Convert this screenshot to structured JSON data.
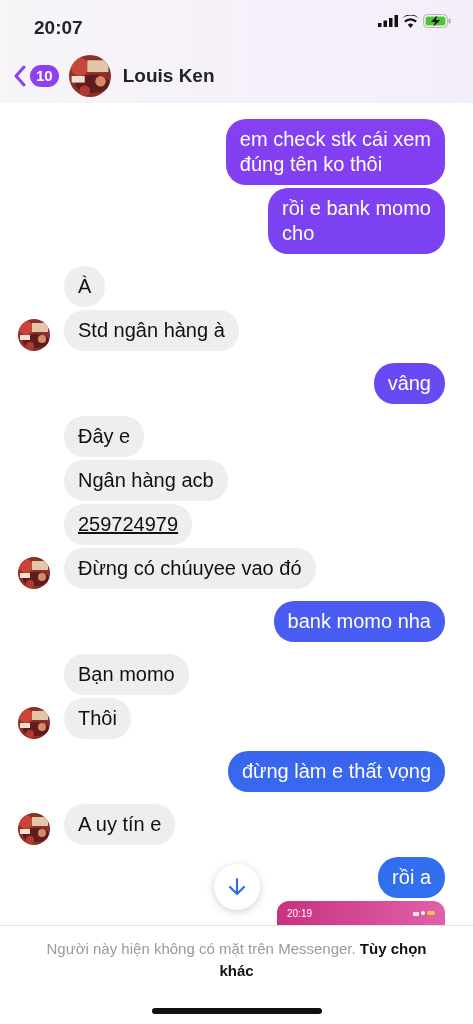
{
  "status_bar": {
    "time": "20:07"
  },
  "header": {
    "back_count": "10",
    "contact_name": "Louis Ken"
  },
  "messages": [
    {
      "outgoing": true,
      "kind": "text",
      "text": "em check stk cái xem\nđúng tên ko thôi"
    },
    {
      "outgoing": true,
      "kind": "text",
      "text": "rồi e bank momo\ncho"
    },
    {
      "outgoing": false,
      "kind": "text",
      "text": "À",
      "avatar": false
    },
    {
      "outgoing": false,
      "kind": "text",
      "text": "Std ngân hàng à",
      "avatar": true
    },
    {
      "outgoing": true,
      "kind": "text",
      "text": "vâng"
    },
    {
      "outgoing": false,
      "kind": "text",
      "text": "Đây e",
      "avatar": false
    },
    {
      "outgoing": false,
      "kind": "text",
      "text": "Ngân hàng acb",
      "avatar": false
    },
    {
      "outgoing": false,
      "kind": "text",
      "text": "259724979",
      "avatar": false,
      "underlined": true
    },
    {
      "outgoing": false,
      "kind": "text",
      "text": "Đừng có chúuyee vao đó",
      "avatar": true
    },
    {
      "outgoing": true,
      "kind": "text",
      "text": "bank momo nha"
    },
    {
      "outgoing": false,
      "kind": "text",
      "text": "Bạn momo",
      "avatar": false
    },
    {
      "outgoing": false,
      "kind": "text",
      "text": "Thôi",
      "avatar": true
    },
    {
      "outgoing": true,
      "kind": "text",
      "text": "đừng làm e thất vọng"
    },
    {
      "outgoing": false,
      "kind": "text",
      "text": "A uy tín e",
      "avatar": true
    },
    {
      "outgoing": true,
      "kind": "text",
      "text": "rồi a"
    },
    {
      "outgoing": true,
      "kind": "screenshot",
      "time": "20:19"
    }
  ],
  "footer": {
    "notice": "Người này hiện không có mặt trên Messenger. **Tùy chọn khác**"
  }
}
